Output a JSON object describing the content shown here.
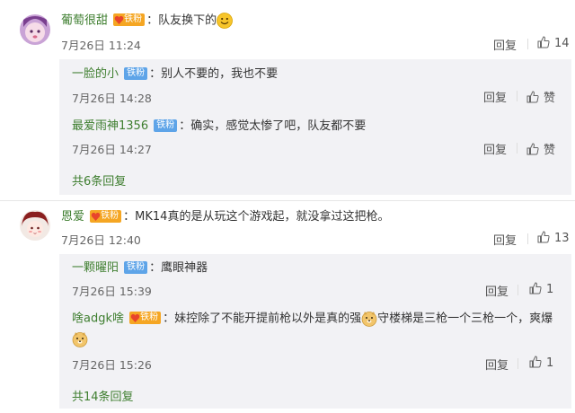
{
  "comments": [
    {
      "username": "葡萄很甜",
      "badge": "铁粉",
      "text": "队友换下的",
      "time": "7月26日 11:24",
      "reply_label": "回复",
      "likes": "14",
      "replies": [
        {
          "username": "一脸的小",
          "badge": "铁粉",
          "text": "别人不要的，我也不要",
          "time": "7月26日 14:28",
          "reply_label": "回复",
          "like_label": "赞"
        },
        {
          "username": "最爱雨神1356",
          "badge": "铁粉",
          "text": "确实，感觉太惨了吧，队友都不要",
          "time": "7月26日 14:27",
          "reply_label": "回复",
          "like_label": "赞"
        }
      ],
      "more": "共6条回复"
    },
    {
      "username": "恩爱",
      "badge": "铁粉",
      "text": "MK14真的是从玩这个游戏起，就没拿过这把枪。",
      "time": "7月26日 12:40",
      "reply_label": "回复",
      "likes": "13",
      "replies": [
        {
          "username": "一颗曜阳",
          "badge": "铁粉",
          "text": "鹰眼神器",
          "time": "7月26日 15:39",
          "reply_label": "回复",
          "likes": "1"
        },
        {
          "username": "啥adgk啥",
          "badge": "铁粉",
          "text_part1": "妹控除了不能开提前枪以外是真的强",
          "text_part2": "守楼梯是三枪一个三枪一个，爽爆",
          "time": "7月26日 15:26",
          "reply_label": "回复",
          "likes": "1"
        }
      ],
      "more": "共14条回复"
    }
  ],
  "colors": {
    "username": "#3e7e2f",
    "badge_blue": "#5ea4e8",
    "badge_orange": "#f5a623",
    "subbox_bg": "#f2f2f5"
  }
}
